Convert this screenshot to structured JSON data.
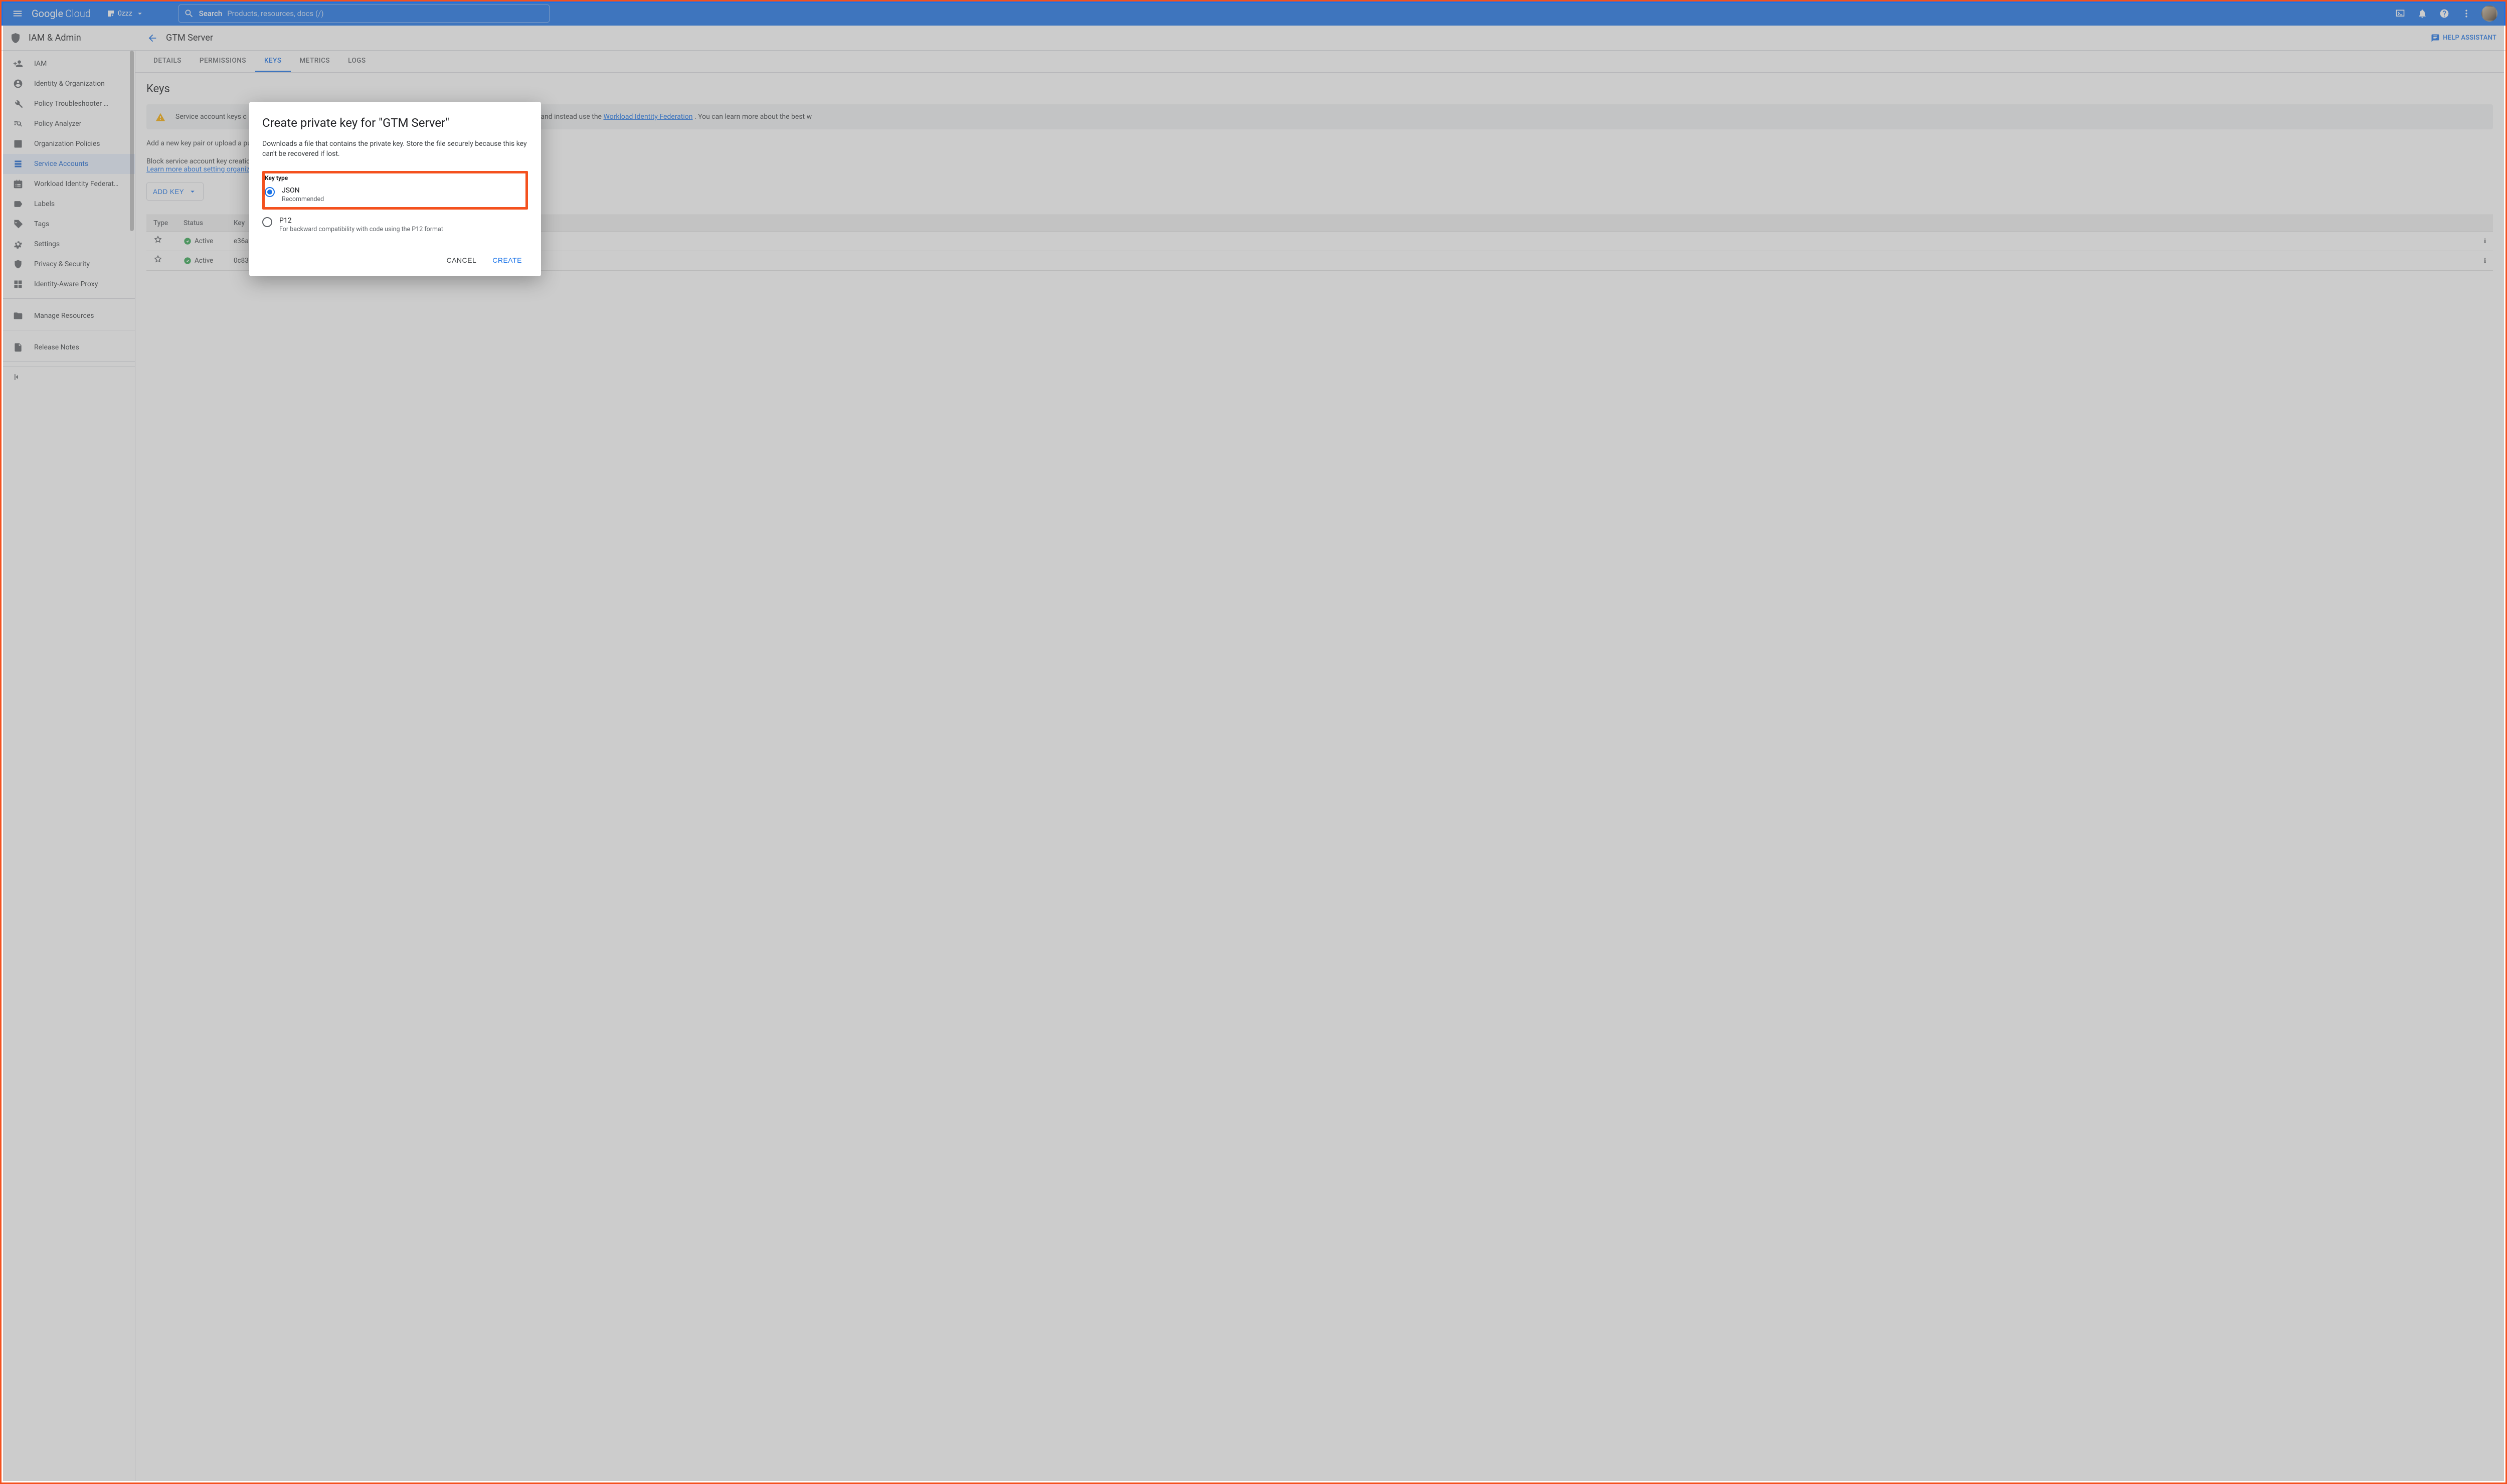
{
  "topbar": {
    "logo_a": "Google",
    "logo_b": "Cloud",
    "project_name": "0zzz",
    "search_label": "Search",
    "search_hint": "Products, resources, docs (/)"
  },
  "product": {
    "title": "IAM & Admin"
  },
  "header": {
    "page_title": "GTM Server",
    "help_assistant": "HELP ASSISTANT"
  },
  "sidebar": {
    "items": [
      {
        "id": "iam",
        "label": "IAM"
      },
      {
        "id": "identity",
        "label": "Identity & Organization"
      },
      {
        "id": "troubleshooter",
        "label": "Policy Troubleshooter …"
      },
      {
        "id": "analyzer",
        "label": "Policy Analyzer"
      },
      {
        "id": "orgpolicies",
        "label": "Organization Policies"
      },
      {
        "id": "service-accounts",
        "label": "Service Accounts"
      },
      {
        "id": "workload",
        "label": "Workload Identity Federat…"
      },
      {
        "id": "labels",
        "label": "Labels"
      },
      {
        "id": "tags",
        "label": "Tags"
      },
      {
        "id": "settings",
        "label": "Settings"
      },
      {
        "id": "privacy",
        "label": "Privacy & Security"
      },
      {
        "id": "iap",
        "label": "Identity-Aware Proxy"
      }
    ],
    "footer_items": [
      {
        "id": "manage-resources",
        "label": "Manage Resources"
      },
      {
        "id": "release-notes",
        "label": "Release Notes"
      }
    ]
  },
  "tabs": [
    "DETAILS",
    "PERMISSIONS",
    "KEYS",
    "METRICS",
    "LOGS"
  ],
  "tabs_active_index": 2,
  "content": {
    "heading": "Keys",
    "warning_a": "Service account keys c",
    "warning_b": "t keys and instead use the ",
    "warning_link": "Workload Identity Federation",
    "warning_c": " . You can learn more about the best w",
    "para1": "Add a new key pair or upload a pu",
    "para2": "Block service account key creatio",
    "para2_link": "Learn more about setting organiza",
    "add_key_label": "ADD KEY",
    "table": {
      "cols": [
        "Type",
        "Status",
        "Key"
      ],
      "rows": [
        {
          "status": "Active",
          "key": "e36a3"
        },
        {
          "status": "Active",
          "key": "0c834"
        }
      ]
    }
  },
  "dialog": {
    "title": "Create private key for \"GTM Server\"",
    "desc": "Downloads a file that contains the private key. Store the file securely because this key can't be recovered if lost.",
    "group_label": "Key type",
    "json_label": "JSON",
    "json_sub": "Recommended",
    "p12_label": "P12",
    "p12_sub": "For backward compatibility with code using the P12 format",
    "cancel": "CANCEL",
    "create": "CREATE"
  }
}
